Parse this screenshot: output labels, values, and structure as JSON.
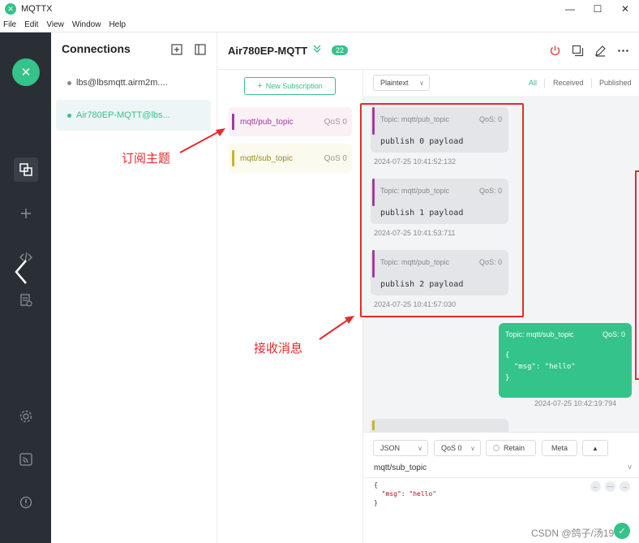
{
  "app": {
    "title": "MQTTX",
    "logo_letter": "✕"
  },
  "menu": [
    "File",
    "Edit",
    "View",
    "Window",
    "Help"
  ],
  "window_controls": {
    "minimize": "—",
    "maximize": "☐",
    "close": "✕"
  },
  "nav": {
    "logo_letter": "✕"
  },
  "connections": {
    "header": "Connections",
    "items": [
      {
        "label": "lbs@lbsmqtt.airm2m....",
        "status_color": "#888888"
      },
      {
        "label": "Air780EP-MQTT@lbs...",
        "status_color": "#34c388"
      }
    ]
  },
  "connection_view": {
    "title": "Air780EP-MQTT",
    "badge": "22",
    "new_subscription": "New Subscription"
  },
  "subscriptions": [
    {
      "topic": "mqtt/pub_topic",
      "qos": "QoS 0",
      "color": "#9b3d9b",
      "bg": "#fbf0f6"
    },
    {
      "topic": "mqtt/sub_topic",
      "qos": "QoS 0",
      "color": "#c8b32c",
      "bg": "#fbfaee"
    }
  ],
  "messages": {
    "format": "Plaintext",
    "filters": {
      "all": "All",
      "received": "Received",
      "published": "Published"
    },
    "received": [
      {
        "topic": "Topic: mqtt/pub_topic",
        "qos": "QoS: 0",
        "payload": "publish 0 payload",
        "time": "2024-07-25 10:41:52:132"
      },
      {
        "topic": "Topic: mqtt/pub_topic",
        "qos": "QoS: 0",
        "payload": "publish 1 payload",
        "time": "2024-07-25 10:41:53:711"
      },
      {
        "topic": "Topic: mqtt/pub_topic",
        "qos": "QoS: 0",
        "payload": "publish 2 payload",
        "time": "2024-07-25 10:41:57:030"
      }
    ],
    "published": {
      "topic": "Topic: mqtt/sub_topic",
      "qos": "QoS: 0",
      "payload": "{\n  \"msg\": \"hello\"\n}",
      "time": "2024-07-25 10:42:19:794"
    }
  },
  "composer": {
    "format": "JSON",
    "qos": "QoS 0",
    "retain": "Retain",
    "meta": "Meta",
    "topic": "mqtt/sub_topic",
    "payload_open": "{",
    "payload_key": "\"msg\"",
    "payload_colon": ": ",
    "payload_val": "\"hello\"",
    "payload_close": "}"
  },
  "annotations": {
    "subscribe": "订阅主题",
    "receive": "接收消息"
  },
  "watermark": "CSDN @鸽子/汤197"
}
